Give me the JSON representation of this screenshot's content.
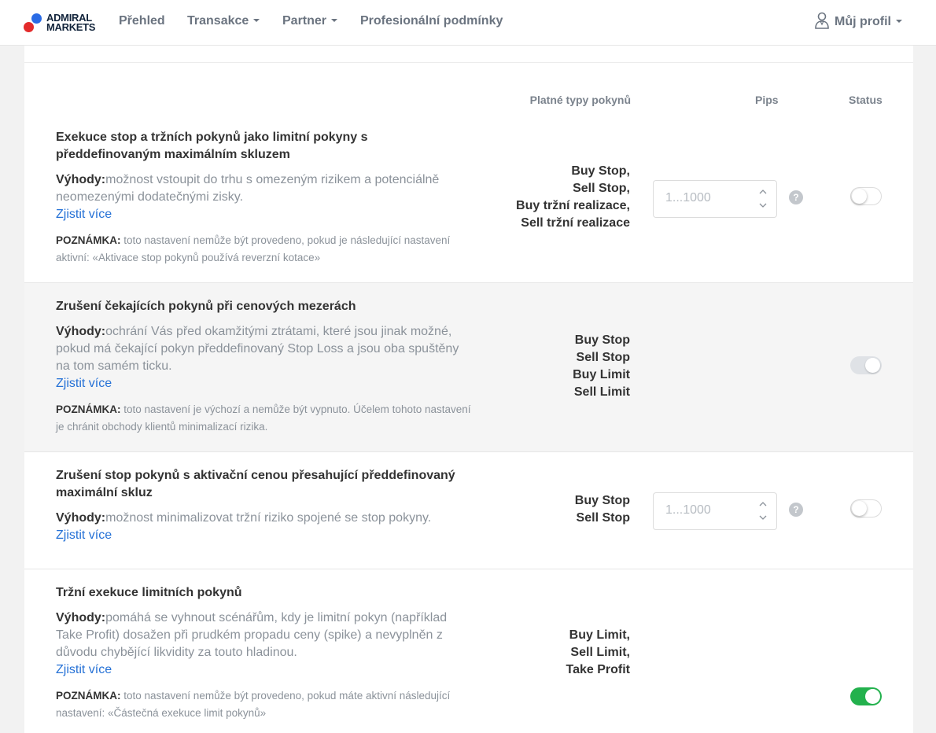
{
  "nav": {
    "logo_line1": "ADMIRAL",
    "logo_line2": "MARKETS",
    "overview": "Přehled",
    "transactions": "Transakce",
    "partner": "Partner",
    "professional": "Profesionální podmínky",
    "profile": "Můj profil"
  },
  "columns": {
    "order_types": "Platné typy pokynů",
    "pips": "Pips",
    "status": "Status"
  },
  "rows": [
    {
      "title": "Exekuce stop a tržních pokynů jako limitní pokyny s předdefinovaným maximálním skluzem",
      "benefit_label": "Výhody:",
      "benefit_text": "možnost vstoupit do trhu s omezeným rizikem a potenciálně neomezenými dodatečnými zisky.",
      "link": "Zjistit více",
      "note_label": "POZNÁMKA:",
      "note_text": " toto nastavení nemůže být provedeno, pokud je následující nastavení aktivní: «Aktivace stop pokynů používá reverzní kotace»",
      "order_types": "Buy Stop,\nSell Stop,\nBuy tržní realizace,\nSell tržní realizace",
      "pips_placeholder": "1...1000",
      "status": "off"
    },
    {
      "title": "Zrušení čekajících pokynů při cenových mezerách",
      "benefit_label": "Výhody:",
      "benefit_text": "ochrání Vás před okamžitými ztrátami, které jsou jinak možné, pokud má čekající pokyn předdefinovaný Stop Loss a jsou oba spuštěny na tom samém ticku.",
      "link": "Zjistit více",
      "note_label": "POZNÁMKA:",
      "note_text": " toto nastavení je výchozí a nemůže být vypnuto. Účelem tohoto nastavení je chránit obchody klientů minimalizací rizika.",
      "order_types": "Buy Stop\nSell Stop\nBuy Limit\nSell Limit",
      "status": "disabled"
    },
    {
      "title": "Zrušení stop pokynů s aktivační cenou přesahující předdefinovaný maximální skluz",
      "benefit_label": "Výhody:",
      "benefit_text": "možnost minimalizovat tržní riziko spojené se stop pokyny.",
      "link": "Zjistit více",
      "order_types": "Buy Stop\nSell Stop",
      "pips_placeholder": "1...1000",
      "status": "off"
    },
    {
      "title": "Tržní exekuce limitních pokynů",
      "benefit_label": "Výhody:",
      "benefit_text": "pomáhá se vyhnout scénářům, kdy je limitní pokyn (například Take Profit) dosažen při prudkém propadu ceny (spike) a nevyplněn z důvodu chybějící likvidity za touto hladinou.",
      "link": "Zjistit více",
      "note_label": "POZNÁMKA:",
      "note_text": " toto nastavení nemůže být provedeno, pokud máte aktivní následující nastavení: «Částečná exekuce limit pokynů»",
      "order_types": "Buy Limit,\nSell Limit,\nTake Profit",
      "status": "on"
    }
  ],
  "colors": {
    "accent_link": "#2571d6",
    "toggle_on": "#23b14d",
    "logo_red": "#e32b2b",
    "logo_blue": "#2a6be5"
  }
}
